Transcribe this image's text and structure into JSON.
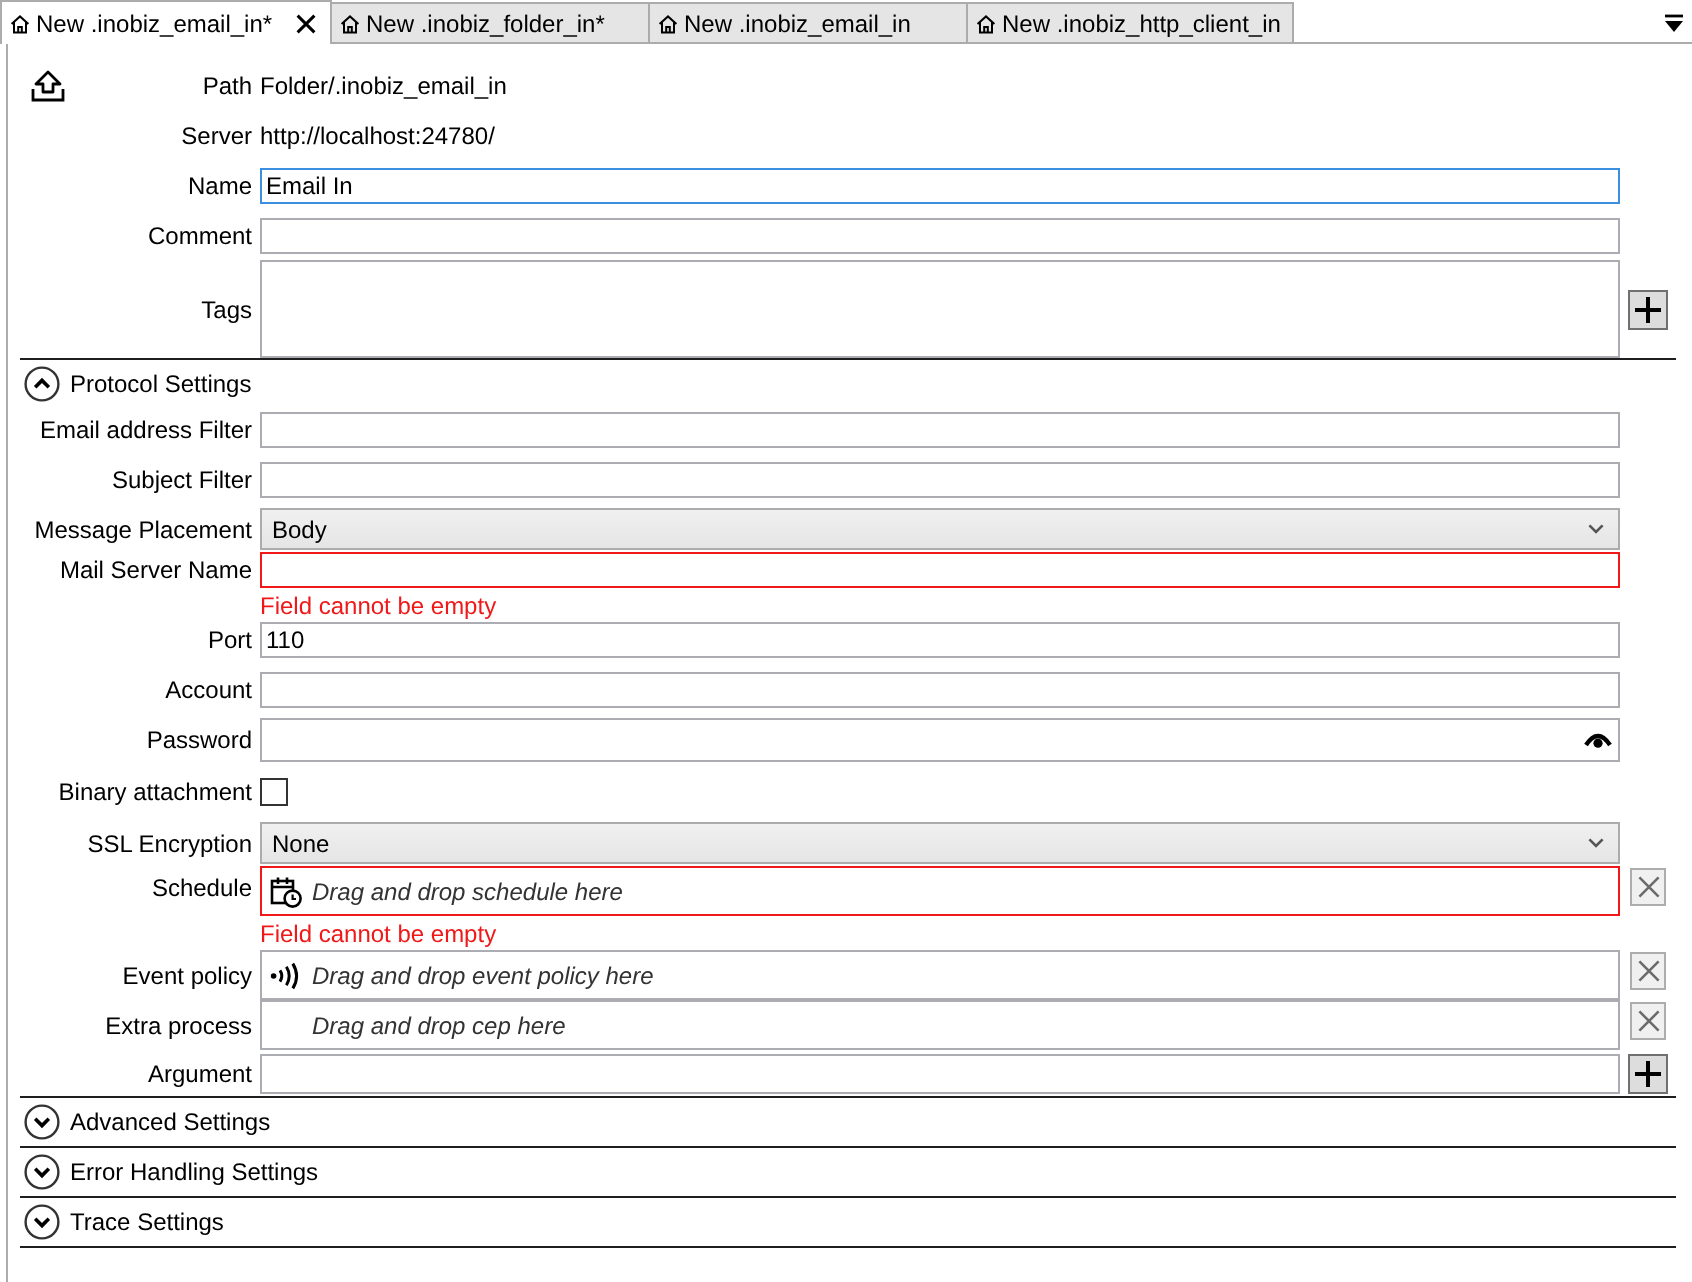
{
  "tabs": [
    {
      "label": "New .inobiz_email_in*",
      "selected": true
    },
    {
      "label": "New .inobiz_folder_in*",
      "selected": false
    },
    {
      "label": "New .inobiz_email_in",
      "selected": false
    },
    {
      "label": "New .inobiz_http_client_in",
      "selected": false
    }
  ],
  "header": {
    "fields": [
      {
        "kind": "static",
        "label": "Path",
        "value": "Folder/.inobiz_email_in"
      },
      {
        "kind": "static",
        "label": "Server",
        "value": "http://localhost:24780/"
      },
      {
        "kind": "input",
        "label": "Name",
        "value": "Email In",
        "focused": true
      },
      {
        "kind": "input",
        "label": "Comment",
        "focused": false
      },
      {
        "kind": "tags",
        "label": "Tags"
      }
    ]
  },
  "sections": [
    {
      "title": "Protocol Settings",
      "expanded": true,
      "fields": [
        {
          "kind": "input",
          "label": "Email address Filter",
          "focused": false
        },
        {
          "kind": "input",
          "label": "Subject Filter",
          "focused": false
        },
        {
          "kind": "select",
          "label": "Message Placement",
          "value": "Body"
        },
        {
          "kind": "input",
          "label": "Mail Server Name",
          "focused": false,
          "error": "Field cannot be empty"
        },
        {
          "kind": "input",
          "label": "Port",
          "value": "110",
          "focused": false
        },
        {
          "kind": "input",
          "label": "Account",
          "focused": false
        },
        {
          "kind": "password",
          "label": "Password"
        },
        {
          "kind": "checkbox",
          "label": "Binary attachment",
          "checked": false
        },
        {
          "kind": "select",
          "label": "SSL Encryption",
          "value": "None"
        },
        {
          "kind": "schedule",
          "label": "Schedule",
          "placeholder": "Drag and drop schedule here",
          "error": "Field cannot be empty"
        },
        {
          "kind": "policy",
          "label": "Event policy",
          "placeholder": "Drag and drop event policy here"
        },
        {
          "kind": "process",
          "label": "Extra process",
          "placeholder": "Drag and drop cep here"
        },
        {
          "kind": "argument",
          "label": "Argument"
        }
      ]
    },
    {
      "title": "Advanced Settings",
      "expanded": false
    },
    {
      "title": "Error Handling Settings",
      "expanded": false
    },
    {
      "title": "Trace Settings",
      "expanded": false
    }
  ]
}
